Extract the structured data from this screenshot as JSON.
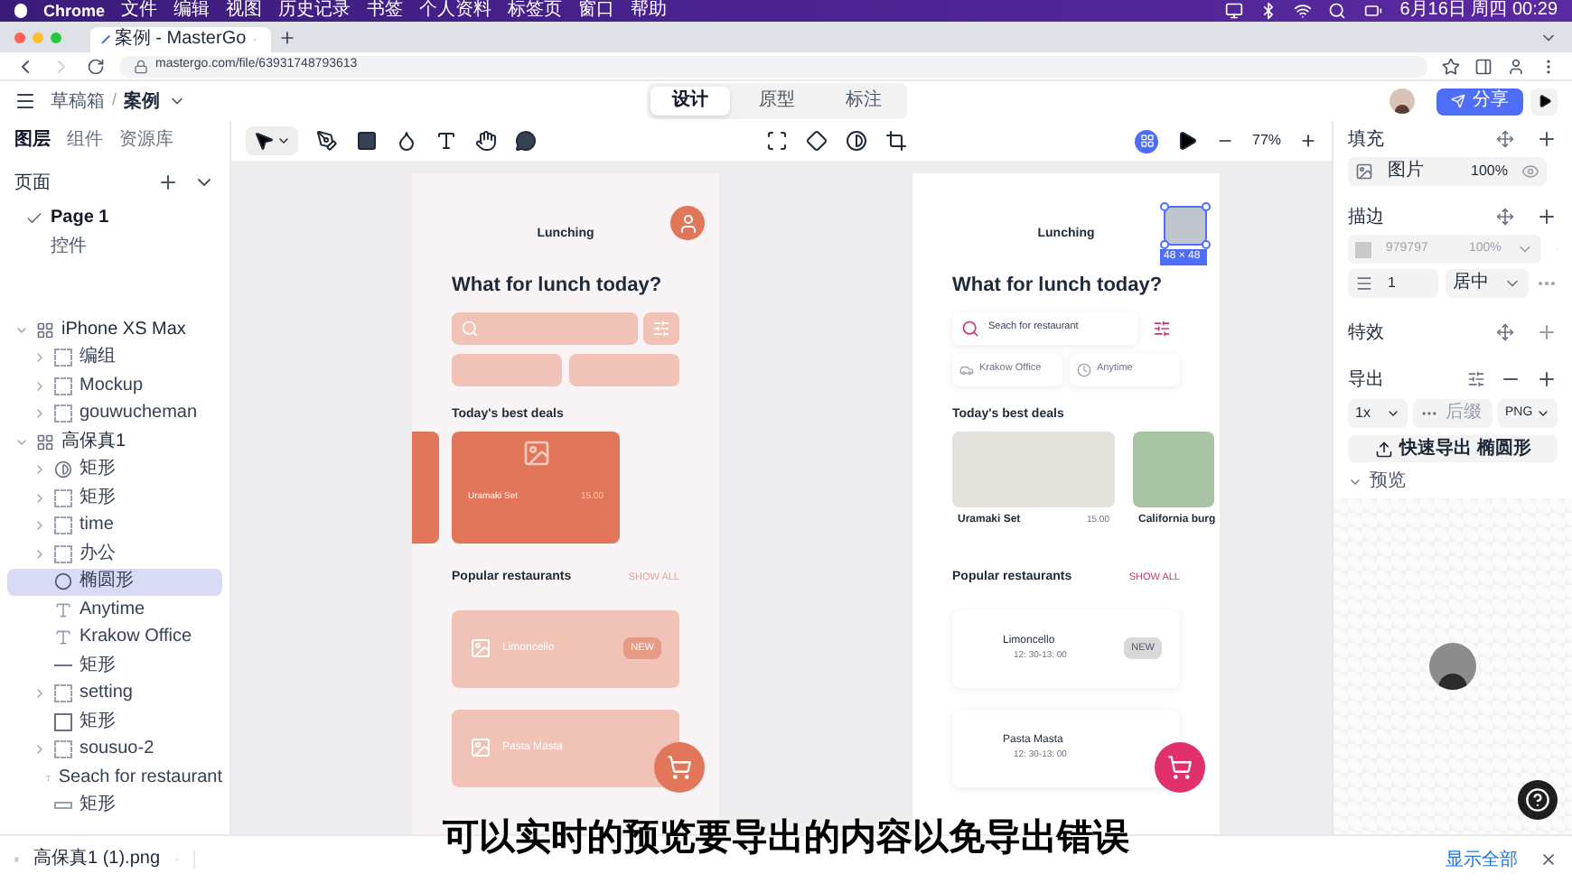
{
  "menubar": {
    "app": "Chrome",
    "menus": [
      "文件",
      "编辑",
      "视图",
      "历史记录",
      "书签",
      "个人资料",
      "标签页",
      "窗口",
      "帮助"
    ],
    "clock": "6月16日 周四 00:29"
  },
  "browser": {
    "tab_title": "案例 - MasterGo",
    "url": "mastergo.com/file/63931748793613"
  },
  "header": {
    "breadcrumb": [
      "草稿箱",
      "案例"
    ],
    "separator": "/",
    "modes": [
      {
        "label": "设计",
        "selected": true
      },
      {
        "label": "原型",
        "selected": false
      },
      {
        "label": "标注",
        "selected": false
      }
    ],
    "share": "分享"
  },
  "toolbar": {
    "zoom": "77%"
  },
  "left_panel": {
    "tabs": [
      {
        "label": "图层",
        "selected": true
      },
      {
        "label": "组件",
        "selected": false
      },
      {
        "label": "资源库",
        "selected": false
      }
    ],
    "pages_title": "页面",
    "pages": [
      {
        "label": "Page 1",
        "selected": true
      },
      {
        "label": "控件",
        "selected": false
      }
    ],
    "layers": [
      {
        "name": "iPhone XS Max",
        "kind": "frame",
        "expanded": true,
        "selected": false,
        "children": [
          {
            "name": "编组",
            "kind": "group",
            "expanded": false,
            "selected": false
          },
          {
            "name": "Mockup",
            "kind": "group",
            "expanded": false,
            "selected": false
          },
          {
            "name": "gouwucheman",
            "kind": "group",
            "expanded": false,
            "selected": false
          }
        ]
      },
      {
        "name": "高保真1",
        "kind": "frame",
        "expanded": true,
        "selected": false,
        "children": [
          {
            "name": "矩形",
            "kind": "mask",
            "expanded": false,
            "selected": false
          },
          {
            "name": "矩形",
            "kind": "group",
            "expanded": false,
            "selected": false
          },
          {
            "name": "time",
            "kind": "group",
            "expanded": false,
            "selected": false
          },
          {
            "name": "办公",
            "kind": "group",
            "expanded": false,
            "selected": false
          },
          {
            "name": "椭圆形",
            "kind": "ellipse",
            "selected": true
          },
          {
            "name": "Anytime",
            "kind": "text",
            "selected": false
          },
          {
            "name": "Krakow Office",
            "kind": "text",
            "selected": false
          },
          {
            "name": "矩形",
            "kind": "line",
            "selected": false
          },
          {
            "name": "setting",
            "kind": "group",
            "expanded": false,
            "selected": false
          },
          {
            "name": "矩形",
            "kind": "rect",
            "selected": false
          },
          {
            "name": "sousuo-2",
            "kind": "group",
            "expanded": false,
            "selected": false
          },
          {
            "name": "Seach for restaurant",
            "kind": "text",
            "selected": false
          },
          {
            "name": "矩形",
            "kind": "bar",
            "selected": false
          }
        ]
      }
    ]
  },
  "canvas": {
    "frames": [
      {
        "kind": "tinted",
        "title": "Lunching",
        "heading": "What for lunch today?",
        "deals_title": "Today's best deals",
        "deals": [
          {
            "name": "Uramaki Set",
            "price": "15.00"
          }
        ],
        "popular_title": "Popular restaurants",
        "show_all": "SHOW ALL",
        "restaurants": [
          {
            "name": "Limoncello",
            "badge": "NEW"
          },
          {
            "name": "Pasta Masta"
          }
        ]
      },
      {
        "kind": "plain",
        "title": "Lunching",
        "heading": "What for lunch today?",
        "search_placeholder": "Seach for restaurant",
        "chips": [
          "Krakow Office",
          "Anytime"
        ],
        "deals_title": "Today's best deals",
        "deals": [
          {
            "name": "Uramaki Set",
            "price": "15.00"
          },
          {
            "name": "California burg"
          }
        ],
        "popular_title": "Popular restaurants",
        "show_all": "SHOW ALL",
        "restaurants": [
          {
            "name": "Limoncello",
            "time": "12: 30-13: 00",
            "badge": "NEW"
          },
          {
            "name": "Pasta Masta",
            "time": "12: 30-13: 00"
          }
        ],
        "selection_size": "48 × 48"
      }
    ]
  },
  "right_panel": {
    "fill": {
      "title": "填充",
      "type": "图片",
      "opacity": "100%"
    },
    "stroke": {
      "title": "描边",
      "hex": "979797",
      "opacity": "100%",
      "disabled": true,
      "weight": "1",
      "align": "居中"
    },
    "effects": {
      "title": "特效"
    },
    "export": {
      "title": "导出",
      "scale": "1x",
      "suffix_placeholder": "后缀",
      "format": "PNG",
      "button": "快速导出 椭圆形"
    },
    "preview": {
      "title": "预览",
      "expanded": true
    }
  },
  "downloads": {
    "file": "高保真1 (1).png",
    "show_all": "显示全部"
  },
  "subtitle": "可以实时的预览要导出的内容以免导出错误"
}
